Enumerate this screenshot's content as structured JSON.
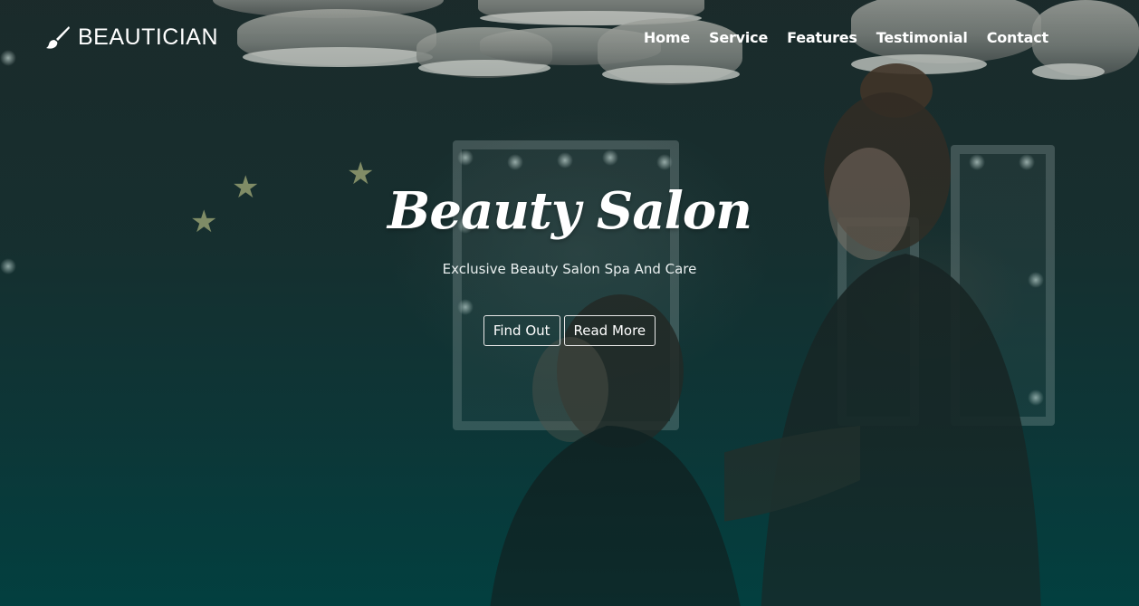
{
  "brand": {
    "name": "BEAUTICIAN",
    "icon": "paint-brush-icon"
  },
  "nav": {
    "items": [
      {
        "label": "Home"
      },
      {
        "label": "Service"
      },
      {
        "label": "Features"
      },
      {
        "label": "Testimonial"
      },
      {
        "label": "Contact"
      }
    ]
  },
  "hero": {
    "title": "Beauty Salon",
    "subtitle": "Exclusive Beauty Salon Spa And Care",
    "buttons": {
      "primary_label": "Find Out",
      "secondary_label": "Read More"
    }
  },
  "colors": {
    "overlay_top": "#1c2b2b",
    "overlay_bottom": "#033c3c",
    "text": "#ffffff",
    "button_border": "#e8e8e8"
  }
}
